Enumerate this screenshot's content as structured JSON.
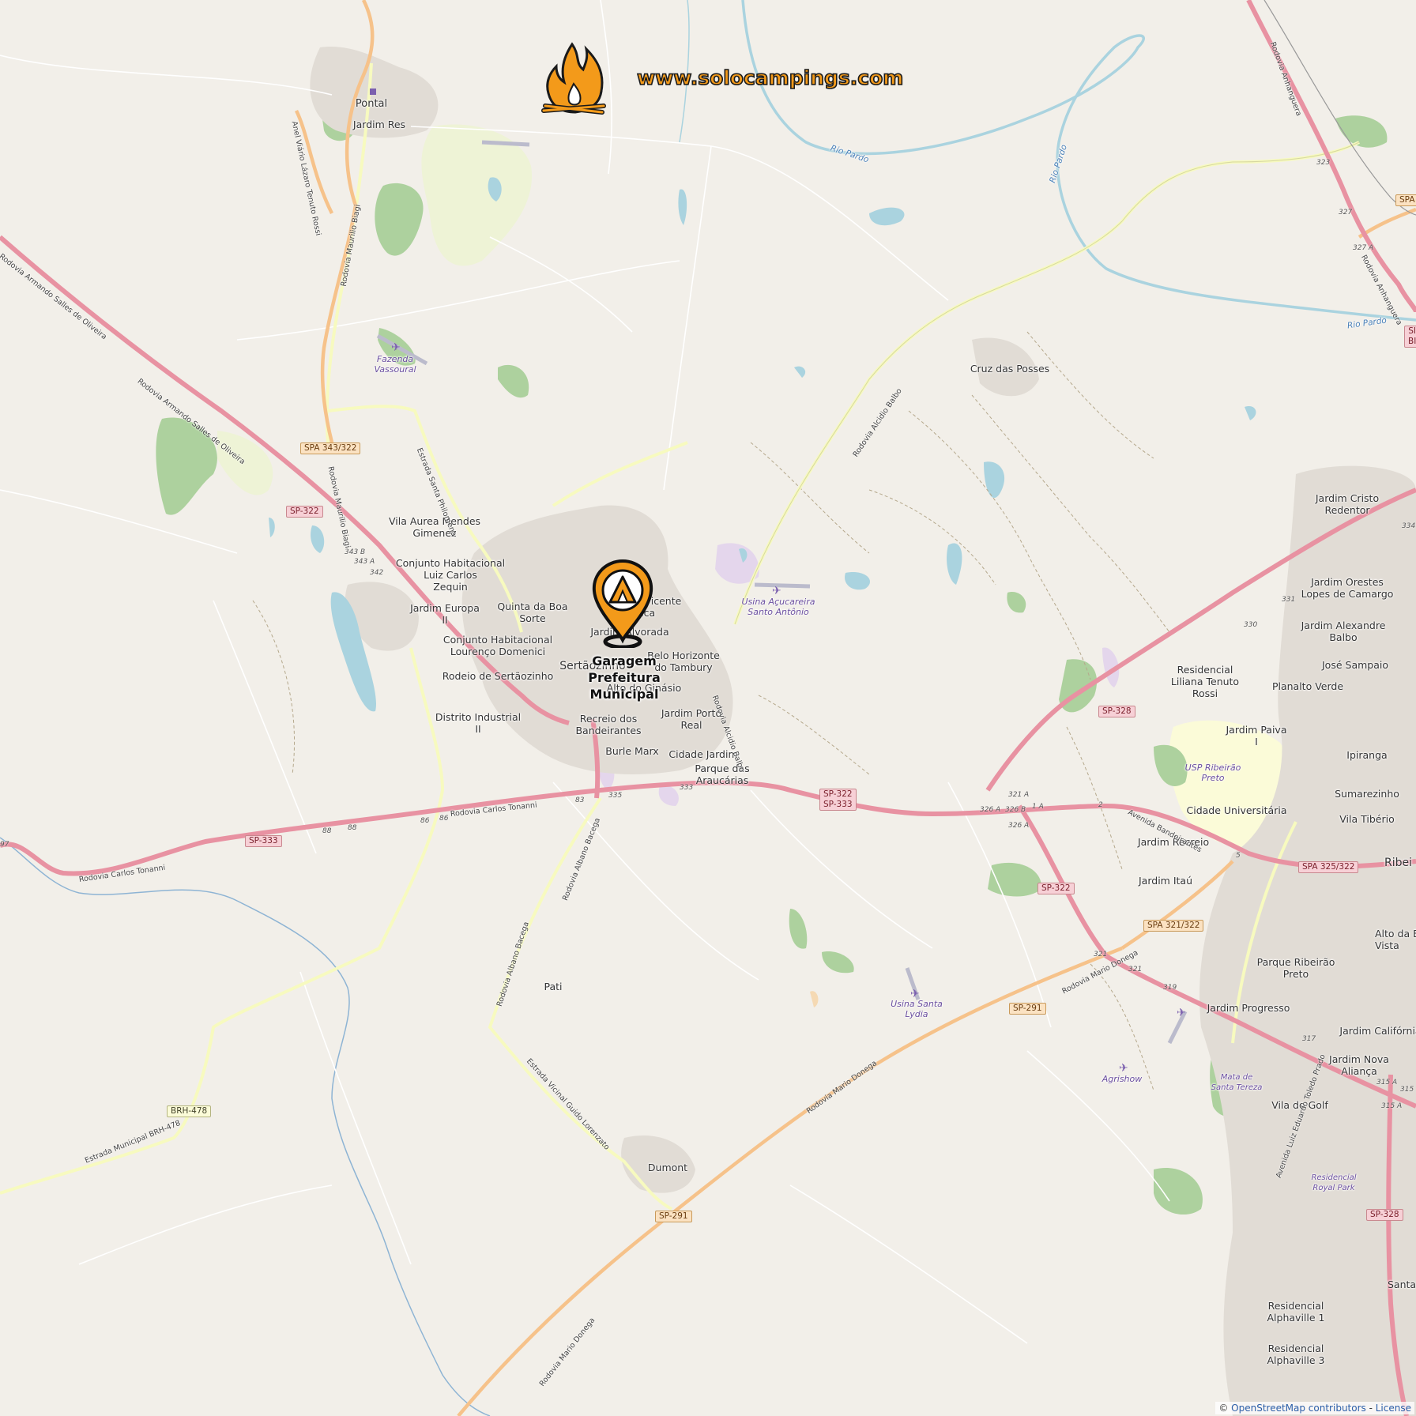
{
  "brand": {
    "website": "www.solocampings.com",
    "logo": "campfire-icon",
    "color": "#f39a1a"
  },
  "marker": {
    "title": "Garagem\nPrefeitura\nMunicipal",
    "icon": "campsite-pin-icon",
    "color": "#f39a1a"
  },
  "attribution": {
    "copyright": "©",
    "source": "OpenStreetMap contributors",
    "separator": " - ",
    "license": "License"
  },
  "places": [
    {
      "name": "Pontal"
    },
    {
      "name": "Jardim Res"
    },
    {
      "name": "Vila Aurea Mendes\nGimenez"
    },
    {
      "name": "Conjunto Habitacional\nLuiz Carlos\nZequin"
    },
    {
      "name": "Jardim Europa\nII"
    },
    {
      "name": "Quinta da Boa\nSorte"
    },
    {
      "name": "Conjunto Habitacional\nLourenço Domenici"
    },
    {
      "name": "Rodeio de Sertãozinho"
    },
    {
      "name": "Sertãozinho"
    },
    {
      "name": "Jardim Vicente\nFica"
    },
    {
      "name": "Jardim Alvorada"
    },
    {
      "name": "Belo Horizonte\ndo Tambury"
    },
    {
      "name": "Alto do Ginásio"
    },
    {
      "name": "Jardim Porto\nReal"
    },
    {
      "name": "Distrito Industrial\nII"
    },
    {
      "name": "Recreio dos\nBandeirantes"
    },
    {
      "name": "Burle Marx"
    },
    {
      "name": "Cidade Jardim"
    },
    {
      "name": "Parque das\nAraucárias"
    },
    {
      "name": "Cruz das Posses"
    },
    {
      "name": "Jardim Cristo\nRedentor"
    },
    {
      "name": "Jardim Orestes\nLopes de Camargo"
    },
    {
      "name": "Jardim Alexandre\nBalbo"
    },
    {
      "name": "José Sampaio"
    },
    {
      "name": "Planalto Verde"
    },
    {
      "name": "Residencial\nLiliana Tenuto\nRossi"
    },
    {
      "name": "Jardim Paiva\nI"
    },
    {
      "name": "Ipiranga"
    },
    {
      "name": "Sumarezinho"
    },
    {
      "name": "Cidade Universitária"
    },
    {
      "name": "Vila Tibério"
    },
    {
      "name": "Jardim Recreio"
    },
    {
      "name": "Jardim Itaú"
    },
    {
      "name": "Ribei"
    },
    {
      "name": "Alto da Bo\nVista"
    },
    {
      "name": "Parque Ribeirão\nPreto"
    },
    {
      "name": "Jardim Progresso"
    },
    {
      "name": "Jardim Califórnia"
    },
    {
      "name": "Jardim Nova\nAliança"
    },
    {
      "name": "Vila do Golf"
    },
    {
      "name": "Pati"
    },
    {
      "name": "Dumont"
    },
    {
      "name": "Residencial\nAlphaville 1"
    },
    {
      "name": "Residencial\nAlphaville 3"
    },
    {
      "name": "Santa"
    }
  ],
  "italic_places": [
    {
      "name": "Fazenda\nVassoural"
    },
    {
      "name": "Usina Açucareira\nSanto Antônio"
    },
    {
      "name": "Usina Santa\nLydia"
    },
    {
      "name": "USP Ribeirão\nPreto"
    },
    {
      "name": "Mata de\nSanta Tereza"
    },
    {
      "name": "Agrishow"
    },
    {
      "name": "Residencial\nRoyal Park"
    }
  ],
  "water_labels": [
    {
      "name": "Rio Pardo"
    },
    {
      "name": "Rio Pardo"
    },
    {
      "name": "Rio Pardo"
    }
  ],
  "shields": [
    {
      "ref": "SPA 343/322",
      "kind": "orange"
    },
    {
      "ref": "SP-322",
      "kind": "pink"
    },
    {
      "ref": "SP-333",
      "kind": "pink"
    },
    {
      "ref": "SP-322\nSP-333",
      "kind": "pink"
    },
    {
      "ref": "SP-328",
      "kind": "pink"
    },
    {
      "ref": "SP-322",
      "kind": "pink"
    },
    {
      "ref": "SPA 321/322",
      "kind": "orange"
    },
    {
      "ref": "SPA 325/322",
      "kind": "pink"
    },
    {
      "ref": "SP-291",
      "kind": "orange"
    },
    {
      "ref": "SP-291",
      "kind": "orange"
    },
    {
      "ref": "BRH-478",
      "kind": "yellow"
    },
    {
      "ref": "SP-328",
      "kind": "pink"
    },
    {
      "ref": "SPA",
      "kind": "orange"
    },
    {
      "ref": "SI\nBI",
      "kind": "pink"
    }
  ],
  "road_names": [
    {
      "name": "Rodovia Armando Salles de Oliveira"
    },
    {
      "name": "Rodovia Armando Salles de Oliveira"
    },
    {
      "name": "Rodovia Carlos Tonanni"
    },
    {
      "name": "Rodovia Carlos Tonanni"
    },
    {
      "name": "Rodovia Albano Bacega"
    },
    {
      "name": "Rodovia Albano Bacega"
    },
    {
      "name": "Rodovia Mario Donega"
    },
    {
      "name": "Rodovia Mario Donega"
    },
    {
      "name": "Rodovia Mario Donega"
    },
    {
      "name": "Rodovia Alcidio Balbo"
    },
    {
      "name": "Rodovia Alcidio Balbo"
    },
    {
      "name": "Rodovia Maurilio Biagi"
    },
    {
      "name": "Rodovia Maurilio Biagi"
    },
    {
      "name": "Estrada Santa Philomena"
    },
    {
      "name": "Estrada Vicinal Guido Lorenzato"
    },
    {
      "name": "Estrada Municipal BRH-478"
    },
    {
      "name": "Anel Viário Lázaro Tenuto Rossi"
    },
    {
      "name": "Avenida Bandeirantes"
    },
    {
      "name": "Rodovia Anhanguera"
    },
    {
      "name": "Rodovia Anhanguera"
    },
    {
      "name": "Avenida Luiz Eduardo Toledo Prado"
    }
  ],
  "road_refs": [
    "343 B",
    "343 A",
    "342",
    "88",
    "88",
    "86",
    "86",
    "83",
    "335",
    "333",
    "326 A",
    "321 A",
    "326 B",
    "326 A",
    "1 A",
    "2",
    "5",
    "321",
    "321",
    "319",
    "317",
    "315 A",
    "315",
    "315 A",
    "323",
    "327",
    "327 A",
    "331",
    "330",
    "334",
    "97"
  ]
}
